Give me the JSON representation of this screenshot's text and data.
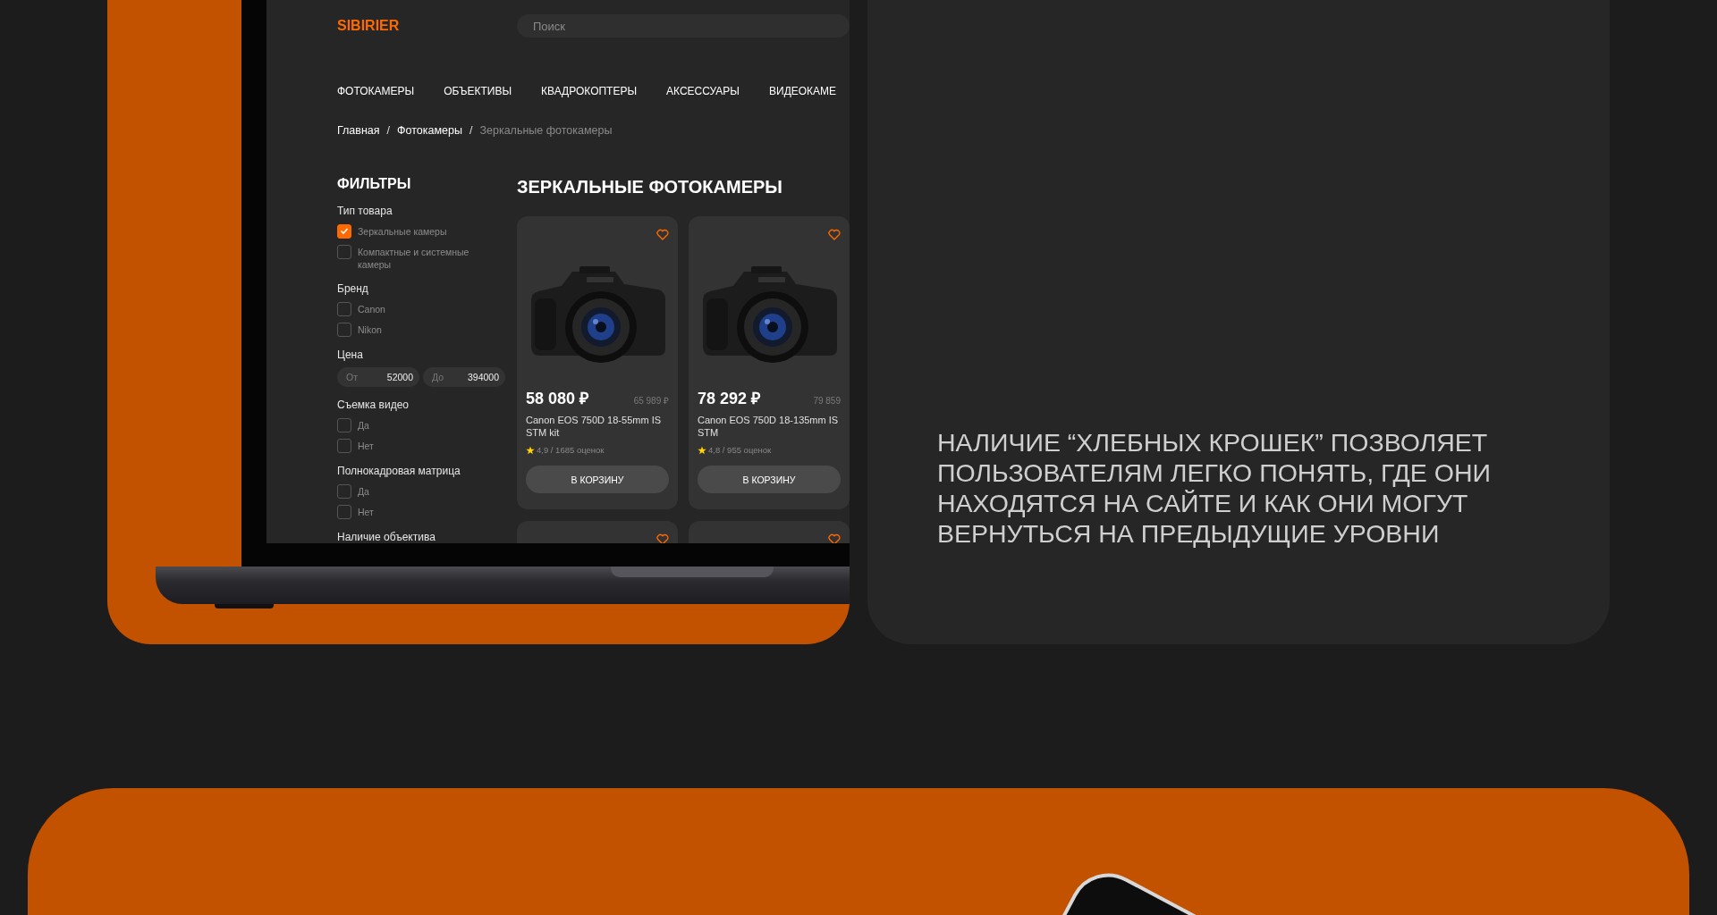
{
  "site": {
    "logo": "SIBIRIER",
    "search": {
      "placeholder": "Поиск"
    },
    "nav": [
      {
        "label": "ФОТОКАМЕРЫ"
      },
      {
        "label": "ОБЪЕКТИВЫ"
      },
      {
        "label": "КВАДРОКОПТЕРЫ"
      },
      {
        "label": "АКСЕССУАРЫ"
      },
      {
        "label": "ВИДЕОКАМЕ"
      }
    ],
    "breadcrumbs": [
      {
        "label": "Главная",
        "current": false,
        "separator": "/"
      },
      {
        "label": "Фотокамеры",
        "current": false,
        "separator": "/"
      },
      {
        "label": "Зеркальные фотокамеры",
        "current": true
      }
    ],
    "filters": {
      "title": "ФИЛЬТРЫ",
      "groups": [
        {
          "kind": "checks",
          "title": "Тип товара",
          "options": [
            {
              "label": "Зеркальные камеры",
              "checked": true
            },
            {
              "label": "Компактные и системные камеры",
              "checked": false
            }
          ]
        },
        {
          "kind": "checks",
          "title": "Бренд",
          "options": [
            {
              "label": "Canon",
              "checked": false
            },
            {
              "label": "Nikon",
              "checked": false
            }
          ]
        },
        {
          "kind": "range",
          "title": "Цена",
          "fields": [
            {
              "label": "От",
              "value": "52000"
            },
            {
              "label": "До",
              "value": "394000"
            }
          ]
        },
        {
          "kind": "checks",
          "title": "Съемка видео",
          "options": [
            {
              "label": "Да",
              "checked": false
            },
            {
              "label": "Нет",
              "checked": false
            }
          ]
        },
        {
          "kind": "checks",
          "title": "Полнокадровая матрица",
          "options": [
            {
              "label": "Да",
              "checked": false
            },
            {
              "label": "Нет",
              "checked": false
            }
          ]
        },
        {
          "kind": "checks",
          "title": "Наличие объектива"
        }
      ]
    },
    "catalog": {
      "title": "ЗЕРКАЛЬНЫЕ ФОТОКАМЕРЫ",
      "products": [
        {
          "favorite": false,
          "price": "58 080 ₽",
          "old_price": "65 989 ₽",
          "name": "Canon EOS 750D 18-55mm IS STM kit",
          "rating": "4,9 / 1685 оценок",
          "button": "В КОРЗИНУ"
        },
        {
          "favorite": false,
          "price": "78 292 ₽",
          "old_price": "79 859",
          "name": "Canon EOS 750D 18-135mm IS STM",
          "rating": "4,8 / 955 оценок",
          "button": "В КОРЗИНУ"
        },
        {
          "favorite": false
        },
        {
          "favorite": false
        }
      ]
    }
  },
  "aside": {
    "text": "НАЛИЧИЕ “ХЛЕБНЫХ КРОШЕК” ПОЗВОЛЯЕТ ПОЛЬЗОВАТЕЛЯМ ЛЕГКО ПОНЯТЬ, ГДЕ ОНИ НАХОДЯТСЯ НА САЙТЕ И КАК ОНИ МОГУТ ВЕРНУТЬСЯ НА ПРЕДЫДУЩИЕ УРОВНИ"
  }
}
